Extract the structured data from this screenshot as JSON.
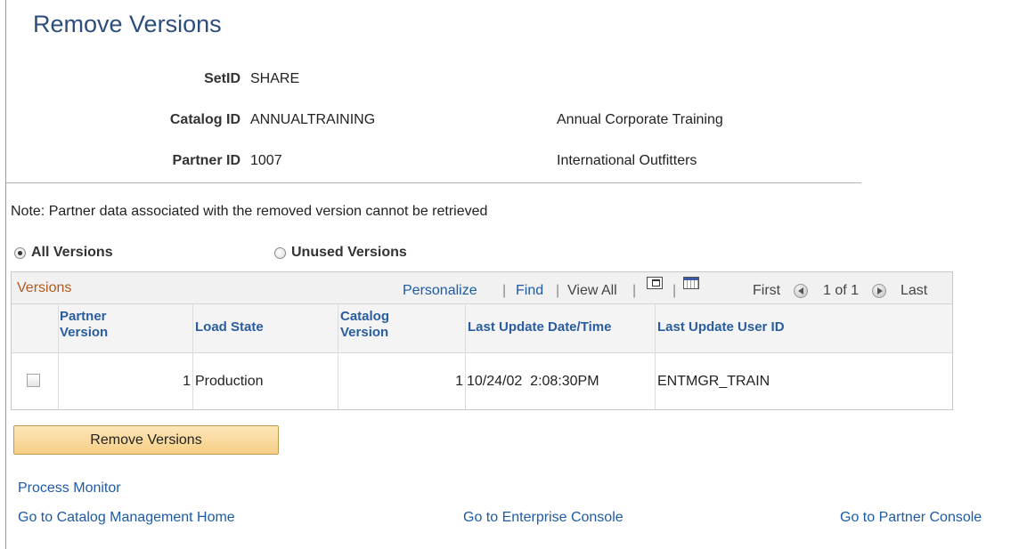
{
  "page": {
    "title": "Remove Versions"
  },
  "fields": {
    "setid_label": "SetID",
    "setid_value": "SHARE",
    "catalog_label": "Catalog ID",
    "catalog_value": "ANNUALTRAINING",
    "catalog_desc": "Annual Corporate Training",
    "partner_label": "Partner ID",
    "partner_value": "1007",
    "partner_desc": "International Outfitters"
  },
  "note": "Note: Partner data associated with the removed version cannot be retrieved",
  "radio": {
    "all_label": "All Versions",
    "unused_label": "Unused Versions",
    "selected": "All Versions"
  },
  "grid": {
    "title": "Versions",
    "personalize": "Personalize",
    "find": "Find",
    "view_all": "View All",
    "sep": "|",
    "first": "First",
    "counter": "1 of 1",
    "last": "Last",
    "columns": {
      "partner_version_1": "Partner",
      "partner_version_2": "Version",
      "load_state": "Load State",
      "catalog_version_1": "Catalog",
      "catalog_version_2": "Version",
      "last_update": "Last Update Date/Time",
      "last_user": "Last Update User ID"
    },
    "rows": [
      {
        "partner_version": "1",
        "load_state": "Production",
        "catalog_version": "1",
        "last_update": "10/24/02  2:08:30PM",
        "last_user": "ENTMGR_TRAIN"
      }
    ]
  },
  "buttons": {
    "remove": "Remove Versions"
  },
  "links": {
    "process_monitor": "Process Monitor",
    "catalog_home": "Go to Catalog Management Home",
    "enterprise_console": "Go to Enterprise Console",
    "partner_console": "Go to Partner Console"
  },
  "icons": {
    "zoom": "zoom-grid-icon",
    "download": "download-to-spreadsheet-icon",
    "prev": "previous-row-icon",
    "next": "next-row-icon"
  },
  "colors": {
    "title": "#2d4e7a",
    "link": "#1d5ba6",
    "grid_title": "#b35a1f",
    "button": "#f6cf86"
  }
}
